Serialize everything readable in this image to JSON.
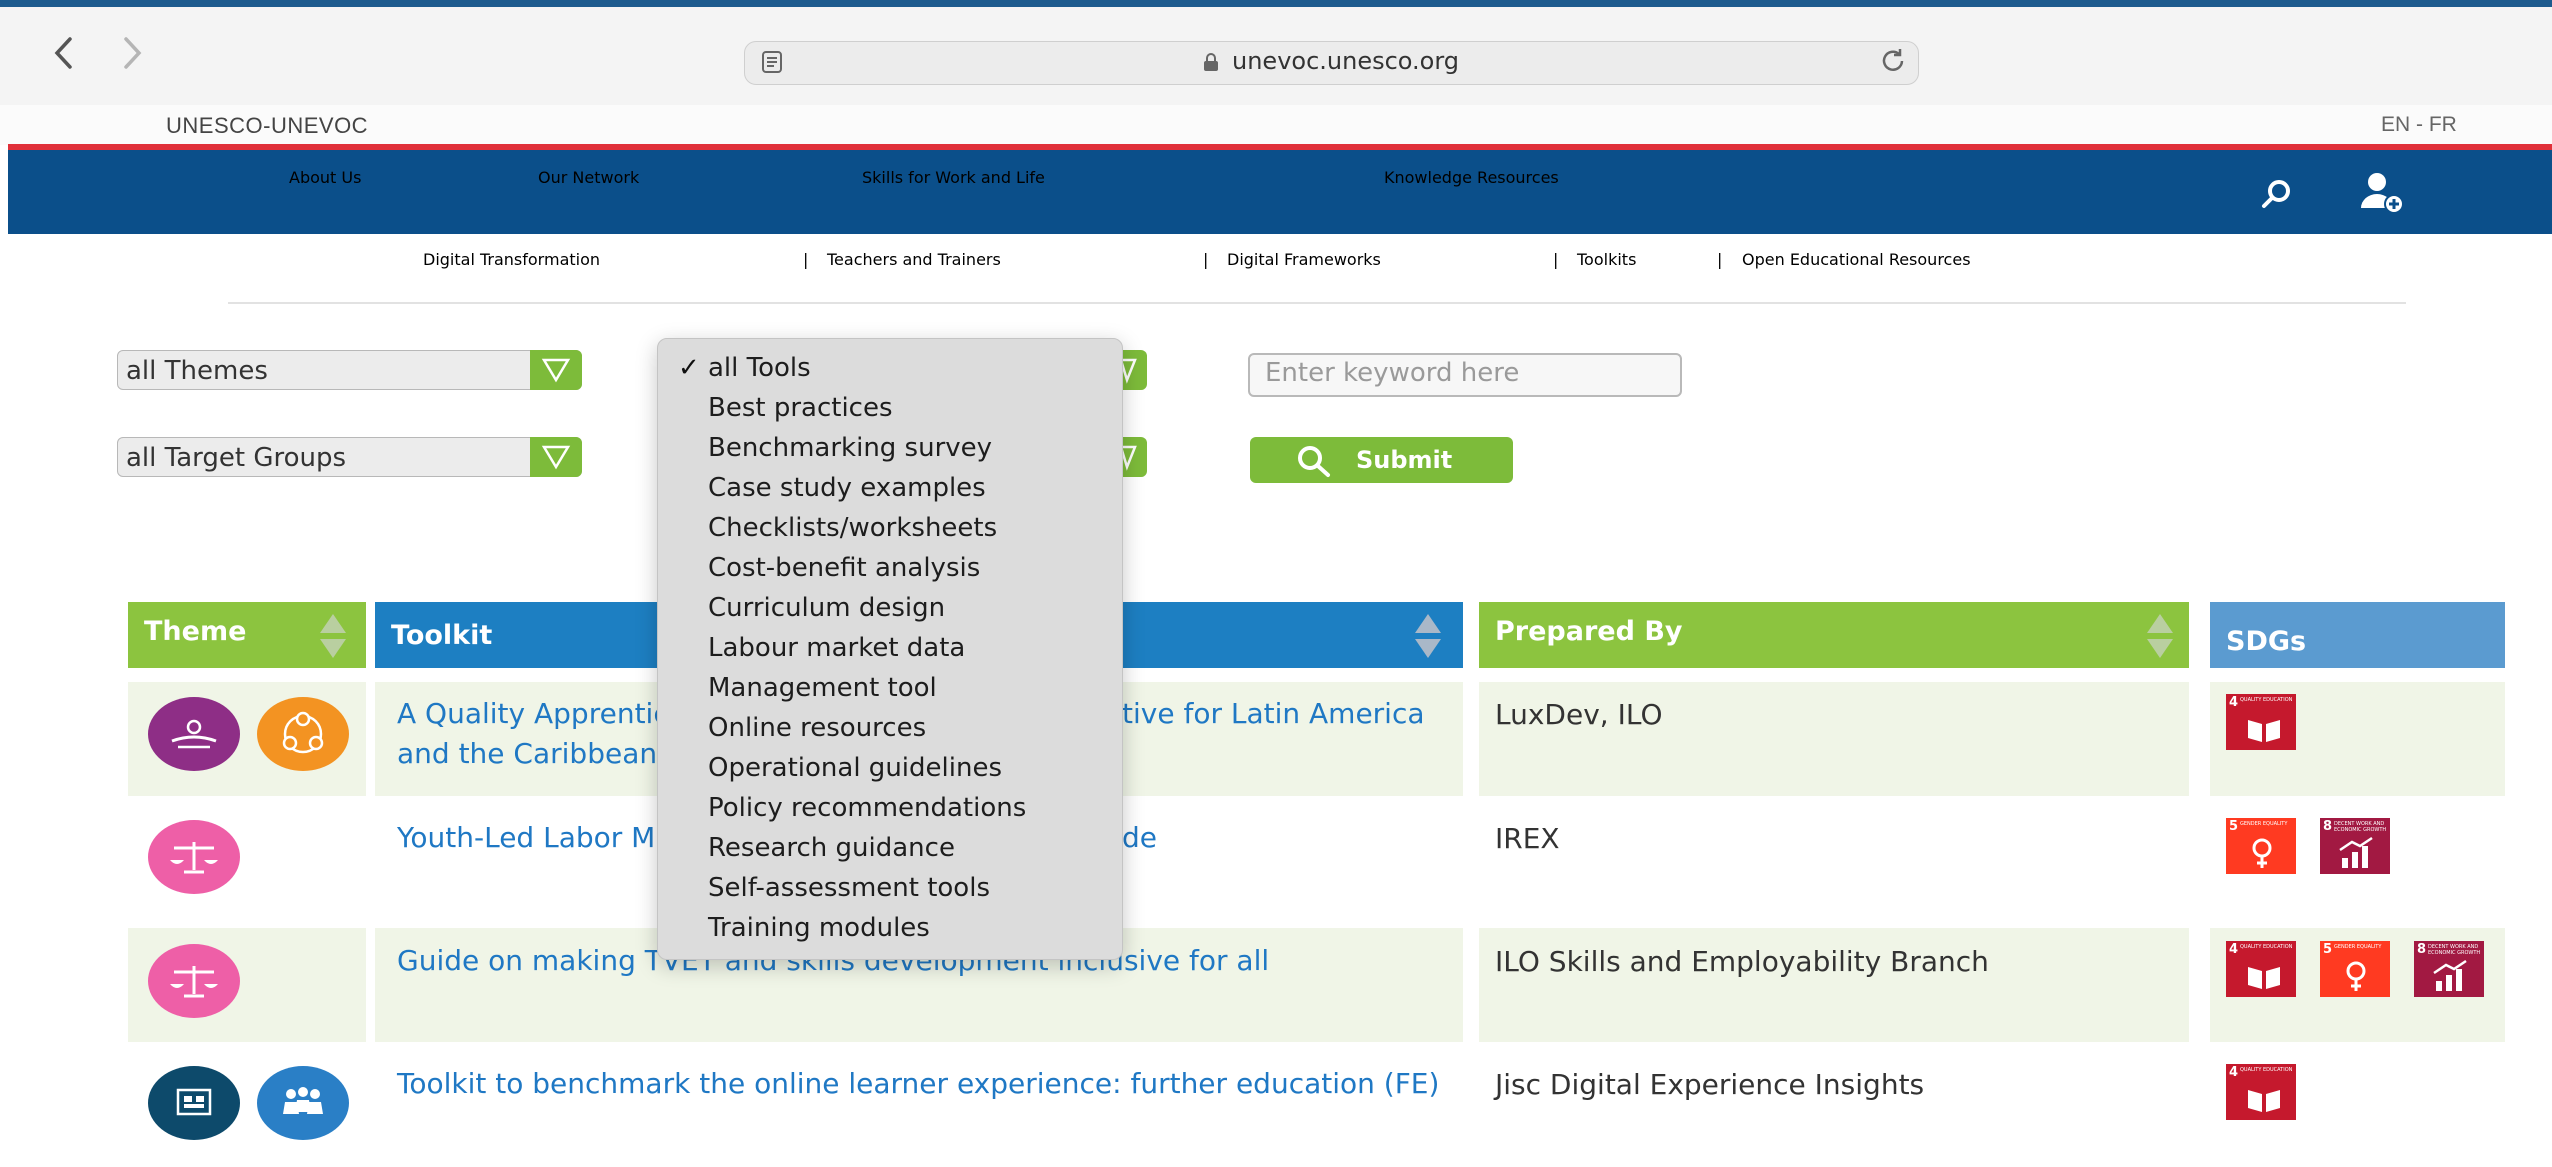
{
  "browser": {
    "url": "unevoc.unesco.org",
    "back_icon": "chevron-left-icon",
    "forward_icon": "chevron-right-icon",
    "reader_icon": "reader-icon",
    "lock_icon": "lock-icon",
    "reload_icon": "reload-icon"
  },
  "site": {
    "brand": "UNESCO-UNEVOC",
    "lang": "EN - FR",
    "accent_blue": "#0b4f8a",
    "accent_green": "#7dbb3a",
    "accent_red": "#e0303a"
  },
  "main_nav": [
    "About Us",
    "Our Network",
    "Skills for Work and Life",
    "Knowledge Resources"
  ],
  "sub_nav": [
    "Digital Transformation",
    "Teachers and Trainers",
    "Digital Frameworks",
    "Toolkits",
    "Open Educational Resources"
  ],
  "filters": {
    "themes": "all Themes",
    "target_groups": "all Target Groups",
    "keyword_placeholder": "Enter keyword here",
    "submit": "Submit"
  },
  "tools_dropdown": {
    "selected": "all Tools",
    "options": [
      "all Tools",
      "Best practices",
      "Benchmarking survey",
      "Case study examples",
      "Checklists/worksheets",
      "Cost-benefit analysis",
      "Curriculum design",
      "Labour market data",
      "Management tool",
      "Online resources",
      "Operational guidelines",
      "Policy recommendations",
      "Research guidance",
      "Self-assessment tools",
      "Training modules"
    ]
  },
  "table": {
    "headers": [
      "Theme",
      "Toolkit",
      "Prepared By",
      "SDGs"
    ],
    "rows": [
      {
        "toolkit_line1": "A Quality Apprentic",
        "toolkit_line1_end": "tive for Latin America",
        "toolkit_line2": "and the Caribbean",
        "prepared_by": "LuxDev, ILO",
        "theme_icons": [
          "hands-icon",
          "network-icon"
        ],
        "sdgs": [
          {
            "num": "4",
            "label": "QUALITY EDUCATION"
          }
        ]
      },
      {
        "toolkit_line1": "Youth-Led Labor M",
        "toolkit_line1_end": "de",
        "prepared_by": "IREX",
        "theme_icons": [
          "scales-icon"
        ],
        "sdgs": [
          {
            "num": "5",
            "label": "GENDER EQUALITY"
          },
          {
            "num": "8",
            "label": "DECENT WORK AND ECONOMIC GROWTH"
          }
        ]
      },
      {
        "toolkit_line1": "Guide on making TVET and skills development inclusive for all",
        "prepared_by": "ILO Skills and Employability Branch",
        "theme_icons": [
          "scales-icon"
        ],
        "sdgs": [
          {
            "num": "4",
            "label": "QUALITY EDUCATION"
          },
          {
            "num": "5",
            "label": "GENDER EQUALITY"
          },
          {
            "num": "8",
            "label": "DECENT WORK AND ECONOMIC GROWTH"
          }
        ]
      },
      {
        "toolkit_line1": "Toolkit to benchmark the online learner experience: further education (FE)",
        "prepared_by": "Jisc Digital Experience Insights",
        "theme_icons": [
          "digital-icon",
          "people-icon"
        ],
        "sdgs": [
          {
            "num": "4",
            "label": "QUALITY EDUCATION"
          }
        ]
      }
    ]
  }
}
